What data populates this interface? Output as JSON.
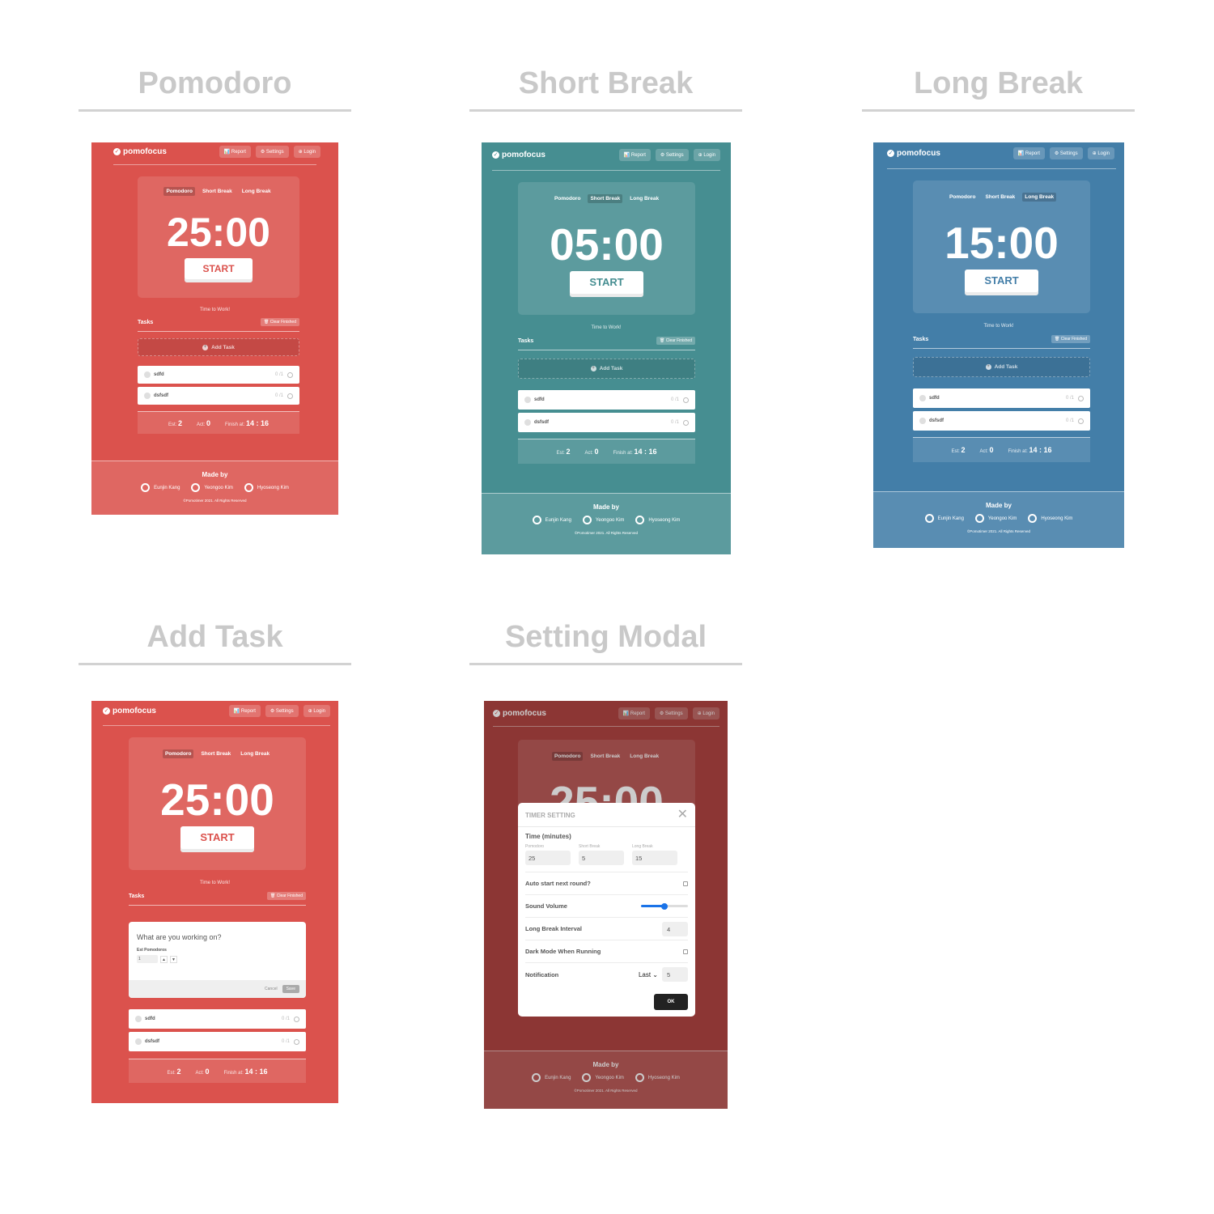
{
  "headings": {
    "pomodoro": "Pomodoro",
    "short_break": "Short Break",
    "long_break": "Long Break",
    "add_task": "Add Task",
    "setting_modal": "Setting Modal"
  },
  "app": {
    "brand": "pomofocus",
    "nav": {
      "report": "📊 Report",
      "settings": "⚙ Settings",
      "login": "⊕ Login"
    },
    "modes": {
      "pomodoro": "Pomodoro",
      "short_break": "Short Break",
      "long_break": "Long Break"
    },
    "start": "START",
    "time_to_work": "Time to Work!",
    "tasks_label": "Tasks",
    "clear_finished": "🗑 Clear Finished",
    "add_task": "Add Task",
    "tasks": [
      {
        "name": "sdfd",
        "count": "0 /1"
      },
      {
        "name": "dsfsdf",
        "count": "0 /1"
      }
    ],
    "summary": {
      "est_label": "Est:",
      "est_value": "2",
      "act_label": "Act:",
      "act_value": "0",
      "finish_label": "Finish at:",
      "finish_value": "14 : 16"
    },
    "footer": {
      "made_by": "Made by",
      "authors": [
        "Eunjin Kang",
        "Yeongoo Kim",
        "Hyoseong Kim"
      ],
      "copyright": "©Pomotimer 2021. All Rights Reserved"
    }
  },
  "screens": {
    "pomodoro": {
      "time": "25:00",
      "active_mode": "pomodoro",
      "theme_color": "#db524d"
    },
    "short_break": {
      "time": "05:00",
      "active_mode": "short_break",
      "theme_color": "#468e91"
    },
    "long_break": {
      "time": "15:00",
      "active_mode": "long_break",
      "theme_color": "#437ea8"
    },
    "add_task": {
      "time": "25:00",
      "active_mode": "pomodoro",
      "theme_color": "#db524d"
    },
    "setting_modal": {
      "time": "25:00",
      "active_mode": "pomodoro",
      "theme_color": "#b04441"
    }
  },
  "add_form": {
    "placeholder": "What are you working on?",
    "est_label": "Est Pomodoros",
    "est_value": "1",
    "cancel": "Cancel",
    "save": "Save"
  },
  "settings_modal": {
    "title": "TIMER SETTING",
    "close": "✕",
    "time_section": "Time (minutes)",
    "fields": [
      {
        "label": "Pomodoro",
        "value": "25"
      },
      {
        "label": "Short Break",
        "value": "5"
      },
      {
        "label": "Long Break",
        "value": "15"
      }
    ],
    "auto_start": "Auto start next round?",
    "auto_start_checked": false,
    "sound_volume": "Sound Volume",
    "sound_volume_level": 0.5,
    "long_break_interval": "Long Break Interval",
    "long_break_interval_value": "4",
    "dark_mode": "Dark Mode When Running",
    "dark_mode_checked": false,
    "notification": "Notification",
    "notification_select": "Last ⌄",
    "notification_value": "5",
    "ok": "OK"
  }
}
